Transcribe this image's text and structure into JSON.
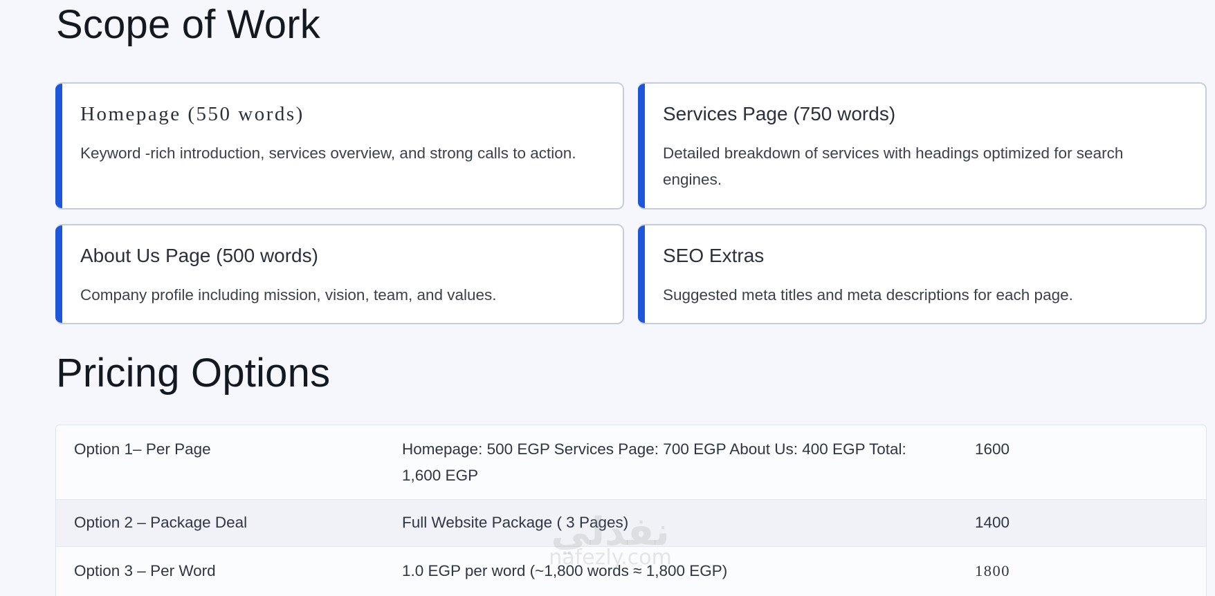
{
  "scope": {
    "title": "Scope of Work",
    "cards": [
      {
        "title": "Homepage (550 words)",
        "description": "Keyword -rich introduction, services overview, and strong calls to action."
      },
      {
        "title": "Services Page  (750  words)",
        "description": "Detailed breakdown of services with headings optimized for search engines."
      },
      {
        "title": "About Us Page   (500  words)",
        "description": "Company profile including mission, vision, team, and values."
      },
      {
        "title": "SEO Extras",
        "description": "Suggested meta titles and meta descriptions for each page."
      }
    ]
  },
  "pricing": {
    "title": "Pricing Options",
    "rows": [
      {
        "option": "Option  1– Per Page",
        "details": "Homepage:  500  EGP Services Page: 700  EGP About Us:  400  EGP Total:  1,600 EGP",
        "price": "1600"
      },
      {
        "option": "Option  2 – Package Deal",
        "details": "Full Website Package (  3 Pages)",
        "price": "1400"
      },
      {
        "option": "Option  3 – Per Word",
        "details": "1.0 EGP per word (~1,800 words  ≈ 1,800 EGP)",
        "price": "1800"
      }
    ]
  },
  "watermark": {
    "arabic": "نفذلي",
    "latin": "nafezly.com"
  }
}
